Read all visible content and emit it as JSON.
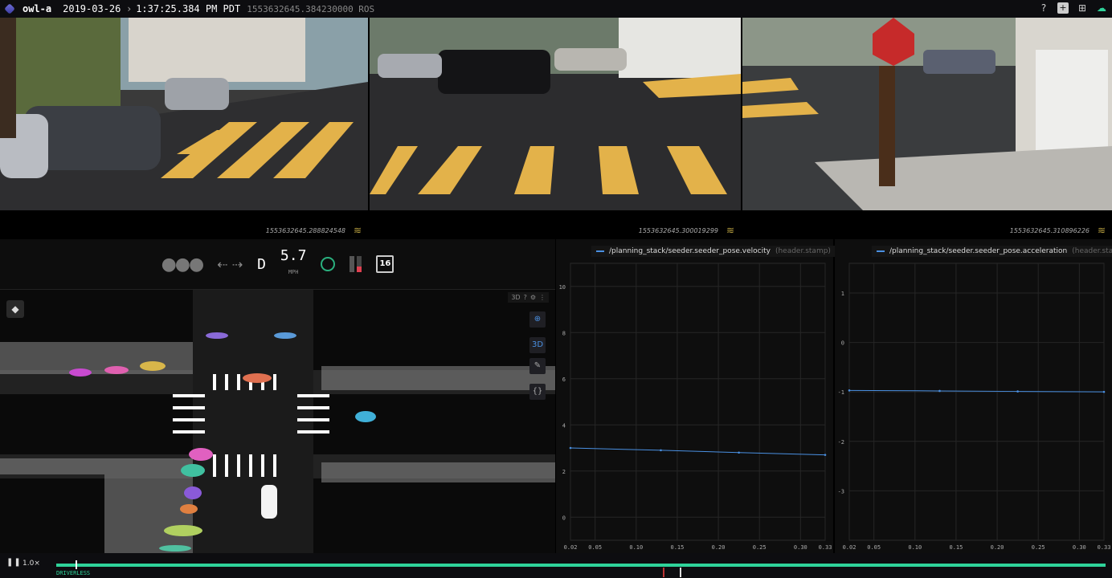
{
  "topbar": {
    "robot": "owl-a",
    "date": "2019-03-26",
    "time": "1:37:25.384 PM PDT",
    "ros_time": "1553632645.384230000 ROS"
  },
  "cameras": [
    {
      "stamp": "1553632645.288824548"
    },
    {
      "stamp": "1553632645.300019299"
    },
    {
      "stamp": "1553632645.310896226"
    }
  ],
  "hud": {
    "gear": "D",
    "speed": "5.7",
    "speed_unit": "MPH",
    "speed_limit": "16"
  },
  "toolbar3d": {
    "mode": "3D"
  },
  "side_buttons": {
    "view_3d": "3D",
    "braces": "{}"
  },
  "plots": [
    {
      "legend": "/planning_stack/seeder.seeder_pose.velocity",
      "legend_stamp": "(header.stamp)",
      "chart_data": {
        "type": "line",
        "xlabel": "",
        "ylabel": "",
        "xlim": [
          0.02,
          0.33
        ],
        "ylim": [
          -1.0,
          11.0
        ],
        "x_ticks": [
          "0.02",
          "0.05",
          "0.10",
          "0.15",
          "0.20",
          "0.25",
          "0.30",
          "0.33"
        ],
        "y_ticks": [
          "0",
          "2",
          "4",
          "6",
          "8",
          "10"
        ],
        "series": [
          {
            "name": "/planning_stack/seeder.seeder_pose.velocity",
            "x": [
              0.02,
              0.13,
              0.225,
              0.33
            ],
            "y": [
              3.0,
              2.9,
              2.8,
              2.7
            ]
          }
        ]
      }
    },
    {
      "legend": "/planning_stack/seeder.seeder_pose.acceleration",
      "legend_stamp": "(header.stamp)",
      "chart_data": {
        "type": "line",
        "xlabel": "",
        "ylabel": "",
        "xlim": [
          0.02,
          0.33
        ],
        "ylim": [
          -4.0,
          1.6
        ],
        "x_ticks": [
          "0.02",
          "0.05",
          "0.10",
          "0.15",
          "0.20",
          "0.25",
          "0.30",
          "0.33"
        ],
        "y_ticks": [
          "1",
          "0",
          "-1",
          "-2",
          "-3"
        ],
        "series": [
          {
            "name": "/planning_stack/seeder.seeder_pose.acceleration",
            "x": [
              0.02,
              0.13,
              0.225,
              0.33
            ],
            "y": [
              -0.97,
              -0.98,
              -0.99,
              -1.0
            ]
          }
        ]
      }
    }
  ],
  "playback": {
    "speed": "1.0×",
    "mode_tag": "DRIVERLESS"
  },
  "colors": {
    "line": "#4a90e2",
    "track": "#2fd39a",
    "crosswalk": "#e3b24a"
  }
}
